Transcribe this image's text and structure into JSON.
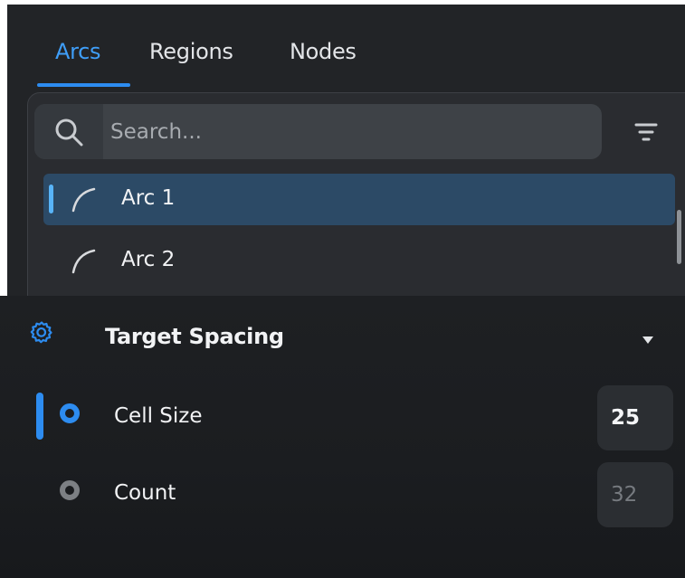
{
  "tabs": [
    {
      "label": "Arcs",
      "active": true
    },
    {
      "label": "Regions",
      "active": false
    },
    {
      "label": "Nodes",
      "active": false
    }
  ],
  "search": {
    "placeholder": "Search...",
    "value": ""
  },
  "list": {
    "items": [
      {
        "label": "Arc 1",
        "selected": true,
        "icon": "arc-icon"
      },
      {
        "label": "Arc 2",
        "selected": false,
        "icon": "arc-icon"
      }
    ]
  },
  "target_spacing": {
    "title": "Target Spacing",
    "icon": "gear-icon",
    "options": [
      {
        "label": "Cell Size",
        "value": "25",
        "selected": true
      },
      {
        "label": "Count",
        "value": "32",
        "selected": false
      }
    ]
  },
  "colors": {
    "accent": "#2d8cf0",
    "active_tab": "#3f9ef8",
    "selected_row": "#2c4a66",
    "panel_background": "#222427"
  }
}
